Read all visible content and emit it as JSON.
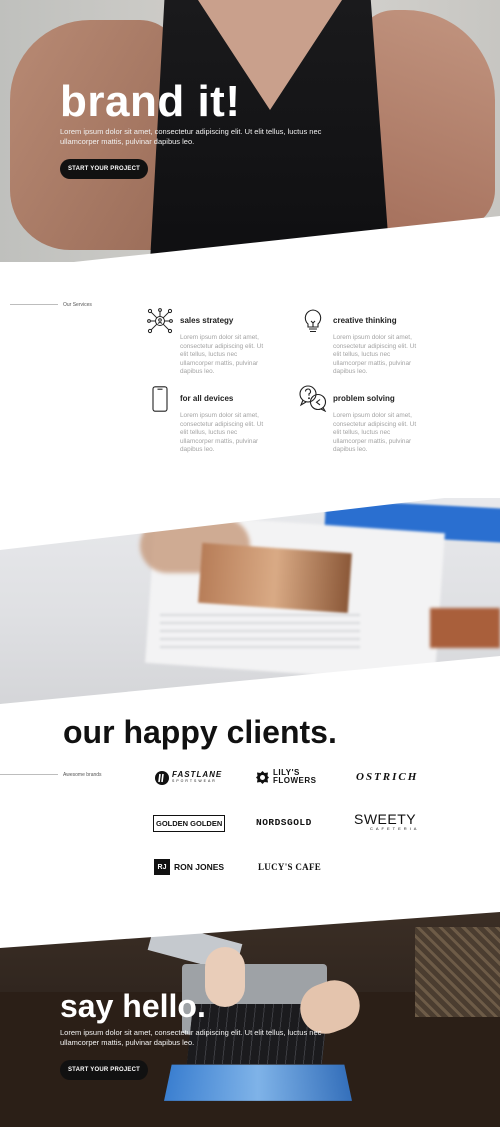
{
  "hero": {
    "title": "brand it!",
    "text": "Lorem ipsum dolor sit amet, consectetur adipiscing elit. Ut elit tellus, luctus nec ullamcorper mattis, pulvinar dapibus leo.",
    "cta": "START YOUR PROJECT"
  },
  "services": {
    "label": "Our Services",
    "items": [
      {
        "icon": "network-icon",
        "title": "sales strategy",
        "text": "Lorem ipsum dolor sit amet, consectetur adipiscing elit. Ut elit tellus, luctus nec ullamcorper mattis, pulvinar dapibus leo."
      },
      {
        "icon": "lightbulb-icon",
        "title": "creative thinking",
        "text": "Lorem ipsum dolor sit amet, consectetur adipiscing elit. Ut elit tellus, luctus nec ullamcorper mattis, pulvinar dapibus leo."
      },
      {
        "icon": "smartphone-icon",
        "title": "for all devices",
        "text": "Lorem ipsum dolor sit amet, consectetur adipiscing elit. Ut elit tellus, luctus nec ullamcorper mattis, pulvinar dapibus leo."
      },
      {
        "icon": "chat-question-icon",
        "title": "problem solving",
        "text": "Lorem ipsum dolor sit amet, consectetur adipiscing elit. Ut elit tellus, luctus nec ullamcorper mattis, pulvinar dapibus leo."
      }
    ]
  },
  "clients": {
    "title": "our happy clients.",
    "label": "Awesome brands",
    "brands": [
      {
        "name": "FASTLANE",
        "sub": "SPORTSWEAR"
      },
      {
        "name": "LILY'S FLOWERS",
        "sub": ""
      },
      {
        "name": "OSTRICH",
        "sub": ""
      },
      {
        "name": "GOLDEN GOLDEN",
        "sub": ""
      },
      {
        "name": "NORDSGOLD",
        "sub": ""
      },
      {
        "name": "SWEETY",
        "sub": "CAFETERIA"
      },
      {
        "name": "RON JONES",
        "sub": "RJ"
      },
      {
        "name": "LUCY'S CAFE",
        "sub": ""
      }
    ]
  },
  "footer": {
    "title": "say hello.",
    "text": "Lorem ipsum dolor sit amet, consectetur adipiscing elit. Ut elit tellus, luctus nec ullamcorper mattis, pulvinar dapibus leo.",
    "cta": "START YOUR PROJECT"
  }
}
